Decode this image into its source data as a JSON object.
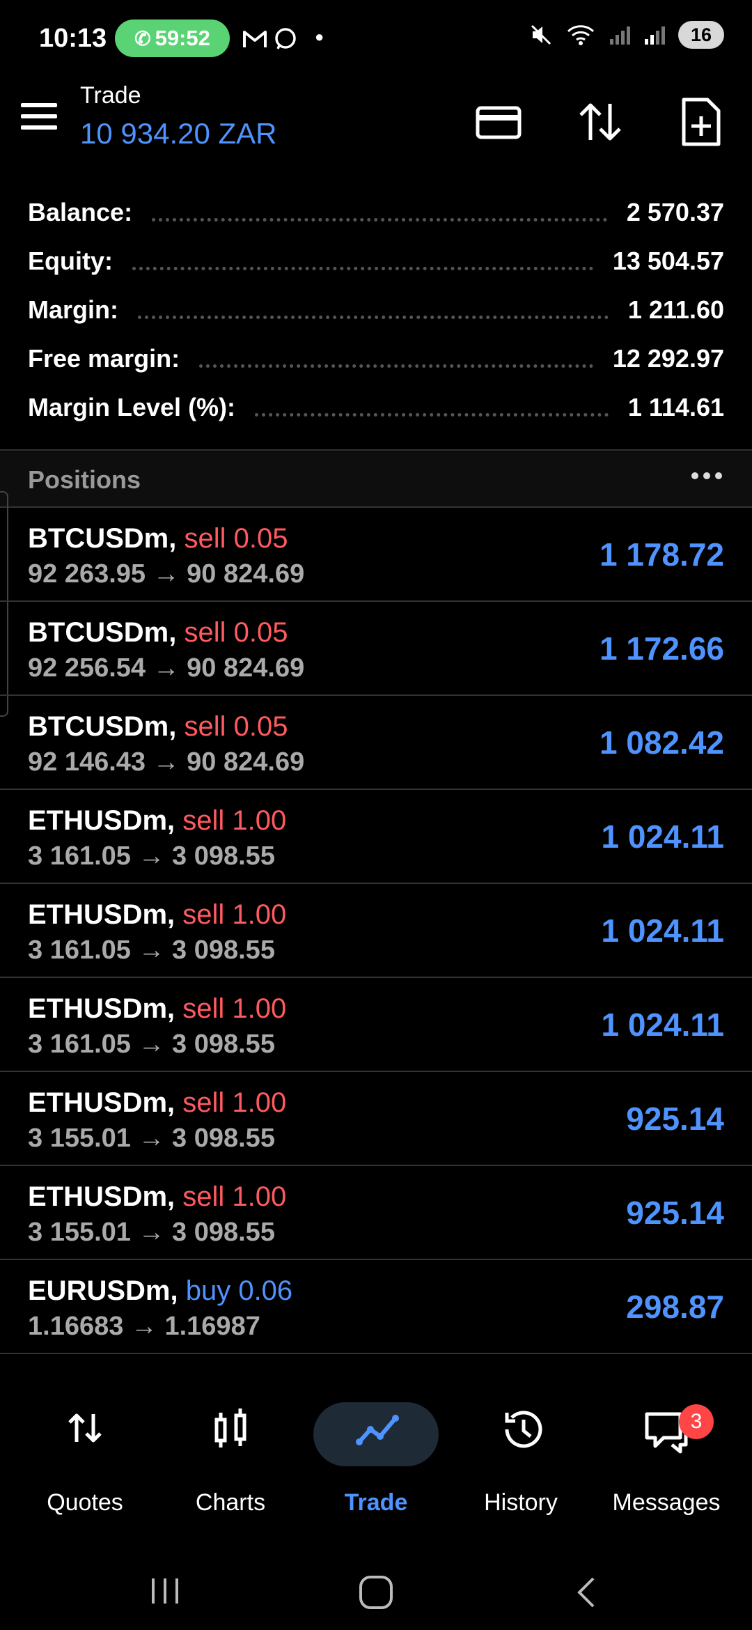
{
  "status_bar": {
    "time": "10:13",
    "call_timer": "59:52",
    "battery": "16"
  },
  "header": {
    "title": "Trade",
    "subtitle": "10 934.20 ZAR"
  },
  "summary": [
    {
      "label": "Balance:",
      "value": "2 570.37"
    },
    {
      "label": "Equity:",
      "value": "13 504.57"
    },
    {
      "label": "Margin:",
      "value": "1 211.60"
    },
    {
      "label": "Free margin:",
      "value": "12 292.97"
    },
    {
      "label": "Margin Level (%):",
      "value": "1 114.61"
    }
  ],
  "positions_header": "Positions",
  "positions": [
    {
      "symbol": "BTCUSDm,",
      "side": "sell 0.05",
      "type": "sell",
      "prices": "92 263.95 → 90 824.69",
      "profit": "1 178.72"
    },
    {
      "symbol": "BTCUSDm,",
      "side": "sell 0.05",
      "type": "sell",
      "prices": "92 256.54 → 90 824.69",
      "profit": "1 172.66"
    },
    {
      "symbol": "BTCUSDm,",
      "side": "sell 0.05",
      "type": "sell",
      "prices": "92 146.43 → 90 824.69",
      "profit": "1 082.42"
    },
    {
      "symbol": "ETHUSDm,",
      "side": "sell 1.00",
      "type": "sell",
      "prices": "3 161.05 → 3 098.55",
      "profit": "1 024.11"
    },
    {
      "symbol": "ETHUSDm,",
      "side": "sell 1.00",
      "type": "sell",
      "prices": "3 161.05 → 3 098.55",
      "profit": "1 024.11"
    },
    {
      "symbol": "ETHUSDm,",
      "side": "sell 1.00",
      "type": "sell",
      "prices": "3 161.05 → 3 098.55",
      "profit": "1 024.11"
    },
    {
      "symbol": "ETHUSDm,",
      "side": "sell 1.00",
      "type": "sell",
      "prices": "3 155.01 → 3 098.55",
      "profit": "925.14"
    },
    {
      "symbol": "ETHUSDm,",
      "side": "sell 1.00",
      "type": "sell",
      "prices": "3 155.01 → 3 098.55",
      "profit": "925.14"
    },
    {
      "symbol": "EURUSDm,",
      "side": "buy 0.06",
      "type": "buy",
      "prices": "1.16683 → 1.16987",
      "profit": "298.87"
    }
  ],
  "nav": {
    "quotes": "Quotes",
    "charts": "Charts",
    "trade": "Trade",
    "history": "History",
    "messages": "Messages",
    "messages_badge": "3"
  },
  "colors": {
    "accent": "#4f93ff",
    "sell": "#ff5a5f",
    "call": "#5ad374"
  }
}
